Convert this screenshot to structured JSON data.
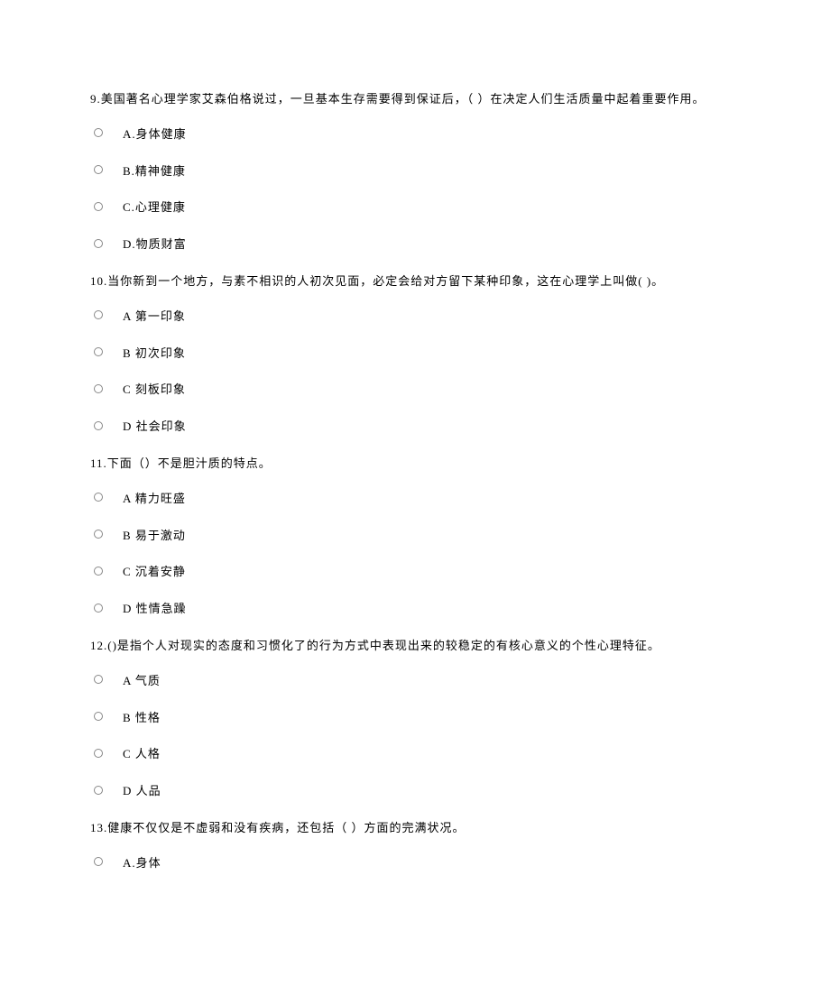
{
  "questions": [
    {
      "number": "9.",
      "text": "美国著名心理学家艾森伯格说过，一旦基本生存需要得到保证后，（ ）在决定人们生活质量中起着重要作用。",
      "options": [
        {
          "label": "A.身体健康"
        },
        {
          "label": "B.精神健康"
        },
        {
          "label": "C.心理健康"
        },
        {
          "label": "D.物质财富"
        }
      ]
    },
    {
      "number": "10.",
      "text": "当你新到一个地方，与素不相识的人初次见面，必定会给对方留下某种印象，这在心理学上叫做( )。",
      "options": [
        {
          "label": "A 第一印象"
        },
        {
          "label": "B 初次印象"
        },
        {
          "label": "C 刻板印象"
        },
        {
          "label": "D 社会印象"
        }
      ]
    },
    {
      "number": "11.",
      "text": "下面（）不是胆汁质的特点。",
      "options": [
        {
          "label": "A 精力旺盛"
        },
        {
          "label": "B 易于激动"
        },
        {
          "label": "C 沉着安静"
        },
        {
          "label": "D 性情急躁"
        }
      ]
    },
    {
      "number": "12.",
      "text": "()是指个人对现实的态度和习惯化了的行为方式中表现出来的较稳定的有核心意义的个性心理特征。",
      "options": [
        {
          "label": "A 气质"
        },
        {
          "label": "B 性格"
        },
        {
          "label": "C 人格"
        },
        {
          "label": "D 人品"
        }
      ]
    },
    {
      "number": "13.",
      "text": "健康不仅仅是不虚弱和没有疾病，还包括（ ）方面的完满状况。",
      "options": [
        {
          "label": "A.身体"
        }
      ]
    }
  ]
}
